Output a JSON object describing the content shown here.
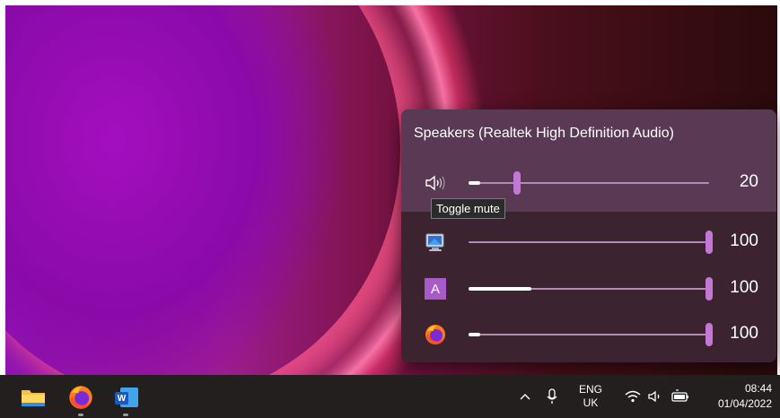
{
  "volume_flyout": {
    "device_name": "Speakers (Realtek High Definition Audio)",
    "tooltip": "Toggle mute",
    "rows": [
      {
        "icon": "speaker-icon",
        "value": 20,
        "value_label": "20",
        "level": 0.2,
        "peak": 0.05
      },
      {
        "icon": "system-sounds-icon",
        "value": 100,
        "value_label": "100",
        "level": 1.0,
        "peak": 0.0
      },
      {
        "icon": "app-a-icon",
        "icon_letter": "A",
        "value": 100,
        "value_label": "100",
        "level": 1.0,
        "peak": 0.26
      },
      {
        "icon": "firefox-icon",
        "value": 100,
        "value_label": "100",
        "level": 1.0,
        "peak": 0.05
      }
    ]
  },
  "taskbar": {
    "apps": [
      {
        "name": "file-explorer-icon"
      },
      {
        "name": "firefox-icon"
      },
      {
        "name": "word-icon",
        "letter": "W"
      }
    ],
    "tray": {
      "language_top": "ENG",
      "language_bottom": "UK",
      "time": "08:44",
      "date": "01/04/2022"
    }
  },
  "colors": {
    "accent": "#c378d6",
    "flyout_top": "#5a3954",
    "flyout_bg": "#3b2330",
    "taskbar": "#231f1f"
  }
}
